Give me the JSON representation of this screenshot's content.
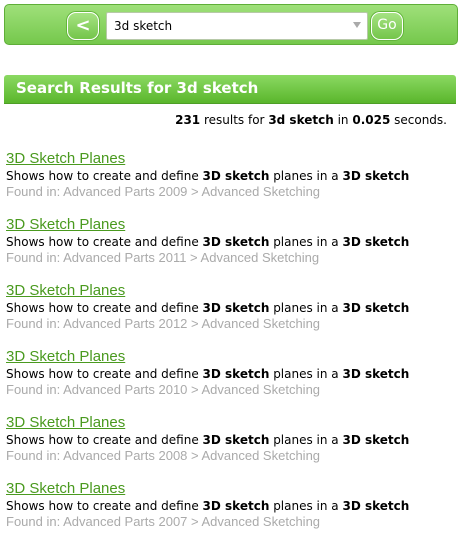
{
  "toolbar": {
    "back_label": "<",
    "search_value": "3d sketch",
    "go_label": "Go"
  },
  "results_header": {
    "title": "Search Results for 3d sketch"
  },
  "summary": {
    "count": "231",
    "text1": " results for ",
    "query": "3d sketch",
    "text2": " in ",
    "seconds": "0.025",
    "text3": " seconds."
  },
  "results": [
    {
      "title": "3D Sketch Planes",
      "desc": [
        "Shows how to create and define ",
        "3D sketch",
        " planes in a ",
        "3D sketch"
      ],
      "path": "Found in: Advanced Parts 2009 > Advanced Sketching"
    },
    {
      "title": "3D Sketch Planes",
      "desc": [
        "Shows how to create and define ",
        "3D sketch",
        " planes in a ",
        "3D sketch"
      ],
      "path": "Found in: Advanced Parts 2011 > Advanced Sketching"
    },
    {
      "title": "3D Sketch Planes",
      "desc": [
        "Shows how to create and define ",
        "3D sketch",
        " planes in a ",
        "3D sketch"
      ],
      "path": "Found in: Advanced Parts 2012 > Advanced Sketching"
    },
    {
      "title": "3D Sketch Planes",
      "desc": [
        "Shows how to create and define ",
        "3D sketch",
        " planes in a ",
        "3D sketch"
      ],
      "path": "Found in: Advanced Parts 2010 > Advanced Sketching"
    },
    {
      "title": "3D Sketch Planes",
      "desc": [
        "Shows how to create and define ",
        "3D sketch",
        " planes in a ",
        "3D sketch"
      ],
      "path": "Found in: Advanced Parts 2008 > Advanced Sketching"
    },
    {
      "title": "3D Sketch Planes",
      "desc": [
        "Shows how to create and define ",
        "3D sketch",
        " planes in a ",
        "3D sketch"
      ],
      "path": "Found in: Advanced Parts 2007 > Advanced Sketching"
    }
  ]
}
